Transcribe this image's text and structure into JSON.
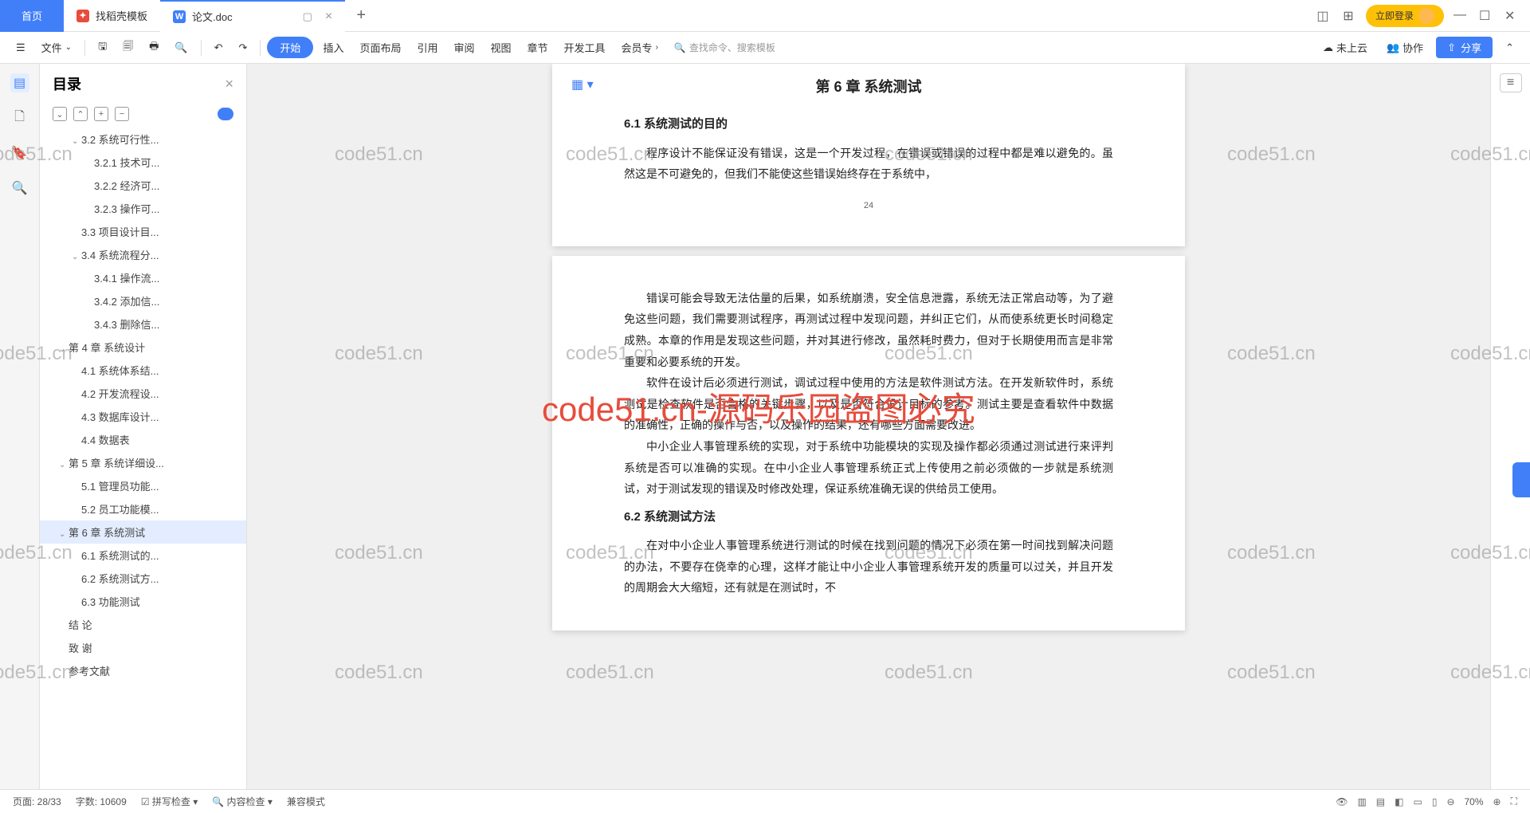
{
  "titlebar": {
    "home": "首页",
    "tab1": "找稻壳模板",
    "tab2": "论文.doc",
    "login": "立即登录"
  },
  "ribbon": {
    "file": "文件",
    "start": "开始",
    "insert": "插入",
    "layout": "页面布局",
    "ref": "引用",
    "review": "审阅",
    "view": "视图",
    "chapter": "章节",
    "dev": "开发工具",
    "member": "会员专",
    "search": "查找命令、搜索模板",
    "notcloud": "未上云",
    "collab": "协作",
    "share": "分享"
  },
  "outline": {
    "title": "目录",
    "items": [
      {
        "text": "3.2 系统可行性...",
        "level": 2,
        "chevron": "⌄"
      },
      {
        "text": "3.2.1 技术可...",
        "level": 3
      },
      {
        "text": "3.2.2 经济可...",
        "level": 3
      },
      {
        "text": "3.2.3 操作可...",
        "level": 3
      },
      {
        "text": "3.3 项目设计目...",
        "level": 2
      },
      {
        "text": "3.4 系统流程分...",
        "level": 2,
        "chevron": "⌄"
      },
      {
        "text": "3.4.1 操作流...",
        "level": 3
      },
      {
        "text": "3.4.2 添加信...",
        "level": 3
      },
      {
        "text": "3.4.3 删除信...",
        "level": 3
      },
      {
        "text": "第 4 章  系统设计",
        "level": 1,
        "chevron": "⌄"
      },
      {
        "text": "4.1 系统体系结...",
        "level": 2
      },
      {
        "text": "4.2 开发流程设...",
        "level": 2
      },
      {
        "text": "4.3 数据库设计...",
        "level": 2
      },
      {
        "text": "4.4 数据表",
        "level": 2
      },
      {
        "text": "第 5 章  系统详细设...",
        "level": 1,
        "chevron": "⌄"
      },
      {
        "text": "5.1 管理员功能...",
        "level": 2
      },
      {
        "text": "5.2 员工功能模...",
        "level": 2
      },
      {
        "text": "第 6 章   系统测试",
        "level": 1,
        "chevron": "⌄",
        "selected": true
      },
      {
        "text": "6.1 系统测试的...",
        "level": 2
      },
      {
        "text": "6.2 系统测试方...",
        "level": 2
      },
      {
        "text": "6.3 功能测试",
        "level": 2
      },
      {
        "text": "结   论",
        "level": 1
      },
      {
        "text": "致   谢",
        "level": 1
      },
      {
        "text": "参考文献",
        "level": 1
      }
    ]
  },
  "doc": {
    "chapter": "第 6 章   系统测试",
    "s61": "6.1 系统测试的目的",
    "p1": "程序设计不能保证没有错误，这是一个开发过程，在错误或错误的过程中都是难以避免的。虽然这是不可避免的，但我们不能使这些错误始终存在于系统中，",
    "pagenum": "24",
    "p2": "错误可能会导致无法估量的后果，如系统崩溃，安全信息泄露，系统无法正常启动等，为了避免这些问题，我们需要测试程序，再测试过程中发现问题，并纠正它们，从而使系统更长时间稳定成熟。本章的作用是发现这些问题，并对其进行修改，虽然耗时费力，但对于长期使用而言是非常重要和必要系统的开发。",
    "p3": "软件在设计后必须进行测试，调试过程中使用的方法是软件测试方法。在开发新软件时，系统测试是检查软件是否合格的关键步骤，以及是否符合设计目标的参考。测试主要是查看软件中数据的准确性，正确的操作与否，以及操作的结果，还有哪些方面需要改进。",
    "p4": "中小企业人事管理系统的实现，对于系统中功能模块的实现及操作都必须通过测试进行来评判系统是否可以准确的实现。在中小企业人事管理系统正式上传使用之前必须做的一步就是系统测试，对于测试发现的错误及时修改处理，保证系统准确无误的供给员工使用。",
    "s62": "6.2 系统测试方法",
    "p5": "在对中小企业人事管理系统进行测试的时候在找到问题的情况下必须在第一时间找到解决问题的办法，不要存在侥幸的心理，这样才能让中小企业人事管理系统开发的质量可以过关，并且开发的周期会大大缩短，还有就是在测试时，不"
  },
  "statusbar": {
    "page": "页面: 28/33",
    "words": "字数: 10609",
    "spell": "拼写检查",
    "content": "内容检查",
    "compat": "兼容模式",
    "zoom": "70%"
  },
  "watermark": {
    "text": "code51.cn",
    "red": "code51.cn-源码乐园盗图必究"
  }
}
